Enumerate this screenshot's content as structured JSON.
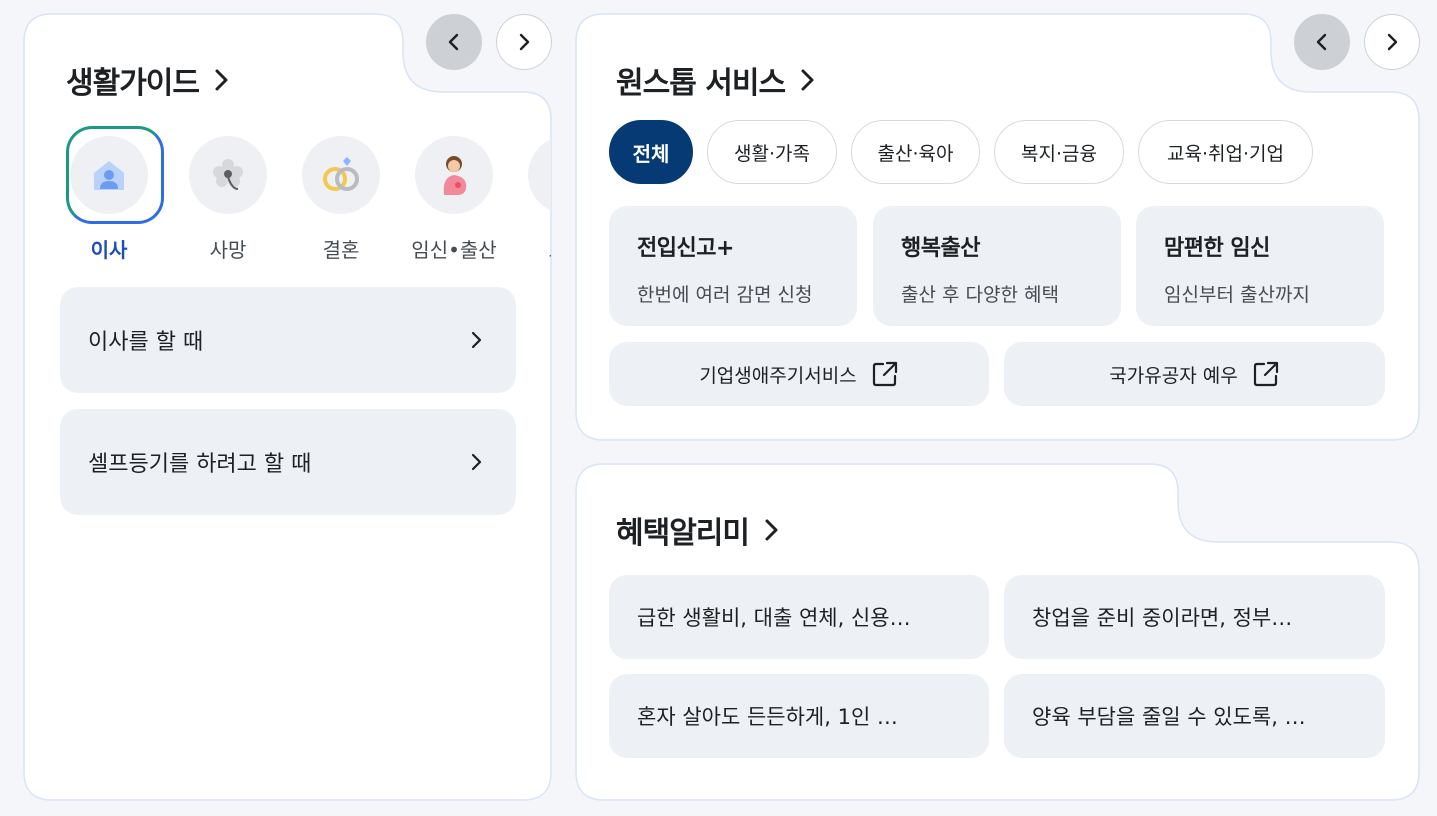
{
  "left_card": {
    "title": "생활가이드",
    "categories": [
      {
        "label": "이사",
        "icon": "house-person-icon",
        "selected": true
      },
      {
        "label": "사망",
        "icon": "flower-icon",
        "selected": false
      },
      {
        "label": "결혼",
        "icon": "rings-icon",
        "selected": false
      },
      {
        "label": "임신•출산",
        "icon": "pregnant-woman-icon",
        "selected": false
      },
      {
        "label": "보건",
        "icon": "health-icon",
        "selected": false
      }
    ],
    "items": [
      {
        "label": "이사를 할 때"
      },
      {
        "label": "셀프등기를 하려고 할 때"
      }
    ]
  },
  "onestop": {
    "title": "원스톱 서비스",
    "chips": [
      "전체",
      "생활·가족",
      "출산·육아",
      "복지·금융",
      "교육·취업·기업"
    ],
    "selected_chip": "전체",
    "services": [
      {
        "title": "전입신고+",
        "desc": "한번에 여러 감면 신청"
      },
      {
        "title": "행복출산",
        "desc": "출산 후 다양한 혜택"
      },
      {
        "title": "맘편한 임신",
        "desc": "임신부터 출산까지"
      }
    ],
    "external_links": [
      {
        "label": "기업생애주기서비스"
      },
      {
        "label": "국가유공자 예우"
      }
    ]
  },
  "benefits": {
    "title": "혜택알리미",
    "items": [
      {
        "label": "급한 생활비, 대출 연체, 신용…"
      },
      {
        "label": "창업을 준비 중이라면, 정부…"
      },
      {
        "label": "혼자 살아도 든든하게, 1인 …"
      },
      {
        "label": "양육 부담을 줄일 수 있도록, …"
      }
    ]
  },
  "colors": {
    "accent_dark_blue": "#063a74",
    "selected_label": "#1e4fb5",
    "card_border": "#d9e4f7",
    "item_bg": "#edf0f4"
  }
}
